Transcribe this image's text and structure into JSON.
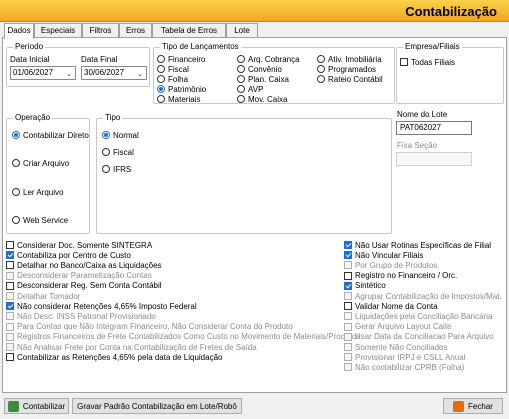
{
  "header": {
    "title": "Contabilização"
  },
  "tabs": [
    "Dados",
    "Especiais",
    "Filtros",
    "Erros",
    "Tabela de Erros",
    "Lote"
  ],
  "periodo": {
    "title": "Período",
    "data_inicial_label": "Data Inicial",
    "data_inicial": "01/06/2027",
    "data_final_label": "Data Final",
    "data_final": "30/06/2027"
  },
  "tipo_lancamentos": {
    "title": "Tipo de Lançamentos",
    "col1": [
      "Financeiro",
      "Fiscal",
      "Folha",
      "Patrimônio",
      "Materiais"
    ],
    "col2": [
      "Arq. Cobrança",
      "Convênio",
      "Plan. Caixa",
      "AVP",
      "Mov. Caixa"
    ],
    "col3": [
      "Ativ. Imobiliária",
      "Programados",
      "Rateio Contábil"
    ],
    "selected": "Patrimônio"
  },
  "empresa_filiais": {
    "title": "Empresa/Filiais",
    "todas_filiais": "Todas Filiais"
  },
  "operacao": {
    "title": "Operação",
    "options": [
      "Contabilizar Direto",
      "Criar Arquivo",
      "Ler Arquivo",
      "Web Service"
    ],
    "selected": "Contabilizar Direto"
  },
  "tipo": {
    "title": "Tipo",
    "options": [
      "Normal",
      "Fiscal",
      "IFRS"
    ],
    "selected": "Normal"
  },
  "lote": {
    "nome_label": "Nome do Lote",
    "nome_value": "PAT062027",
    "fixa_secao_label": "Fixa Seção",
    "fixa_secao_value": ""
  },
  "left_checks": [
    {
      "label": "Considerar Doc. Somente SINTEGRA",
      "checked": false,
      "disabled": false
    },
    {
      "label": "Contabiliza por Centro de Custo",
      "checked": true,
      "disabled": false
    },
    {
      "label": "Detalhar no Banco/Caixa as Liquidações",
      "checked": false,
      "disabled": false
    },
    {
      "label": "Desconsiderar Parametização Contas",
      "checked": false,
      "disabled": true
    },
    {
      "label": "Desconsiderar Reg. Sem Conta Contábil",
      "checked": false,
      "disabled": false
    },
    {
      "label": "Detalhar Tomador",
      "checked": false,
      "disabled": true
    },
    {
      "label": "Não considerar Retenções 4,65% Imposto Federal",
      "checked": true,
      "disabled": false
    },
    {
      "label": "Não Desc. INSS Patronal Provisionado",
      "checked": false,
      "disabled": true
    },
    {
      "label": "Para Contas que Não Integram Financeiro, Não Considerar Conta do Produto",
      "checked": false,
      "disabled": true
    },
    {
      "label": "Registros Financeiros de Frete Contabilizados Como Custo no Movimento de Materiais/Produtos",
      "checked": false,
      "disabled": true
    },
    {
      "label": "Não Analisar Frete por Conta na Contabilização de Fretes de Saída",
      "checked": false,
      "disabled": true
    },
    {
      "label": "Contabilizar as Retenções 4,65% pela data de Liquidação",
      "checked": false,
      "disabled": false
    }
  ],
  "right_checks": [
    {
      "label": "Não Usar Rotinas Específicas de Filial",
      "checked": true,
      "disabled": false
    },
    {
      "label": "Não Vincular Filiais",
      "checked": true,
      "disabled": false
    },
    {
      "label": "Por Grupo de Produtos",
      "checked": false,
      "disabled": true
    },
    {
      "label": "Registro no Financeiro / Orc.",
      "checked": false,
      "disabled": false
    },
    {
      "label": "Sintético",
      "checked": true,
      "disabled": false
    },
    {
      "label": "Agrupar Contabilização de Impostos/Mat.",
      "checked": false,
      "disabled": true
    },
    {
      "label": "Validar Nome da Conta",
      "checked": false,
      "disabled": false
    },
    {
      "label": "Liquidações pela Conciliação Bancária",
      "checked": false,
      "disabled": true
    },
    {
      "label": "Gerar Arquivo Layout Caite",
      "checked": false,
      "disabled": true
    },
    {
      "label": "Usar Data da Conciliacao Para Arquivo",
      "checked": false,
      "disabled": true
    },
    {
      "label": "Somente Não Conciliados",
      "checked": false,
      "disabled": true
    },
    {
      "label": "Provisionar IRPJ e CSLL Anual",
      "checked": false,
      "disabled": true
    },
    {
      "label": "Não contabilizar CPRB (Folha)",
      "checked": false,
      "disabled": true
    }
  ],
  "buttons": {
    "contabilizar": "Contabilizar",
    "gravar": "Gravar Padrão Contabilização em Lote/Robô",
    "fechar": "Fechar"
  },
  "colors": {
    "header": "#f0a820",
    "accent": "#1e6fd9"
  }
}
